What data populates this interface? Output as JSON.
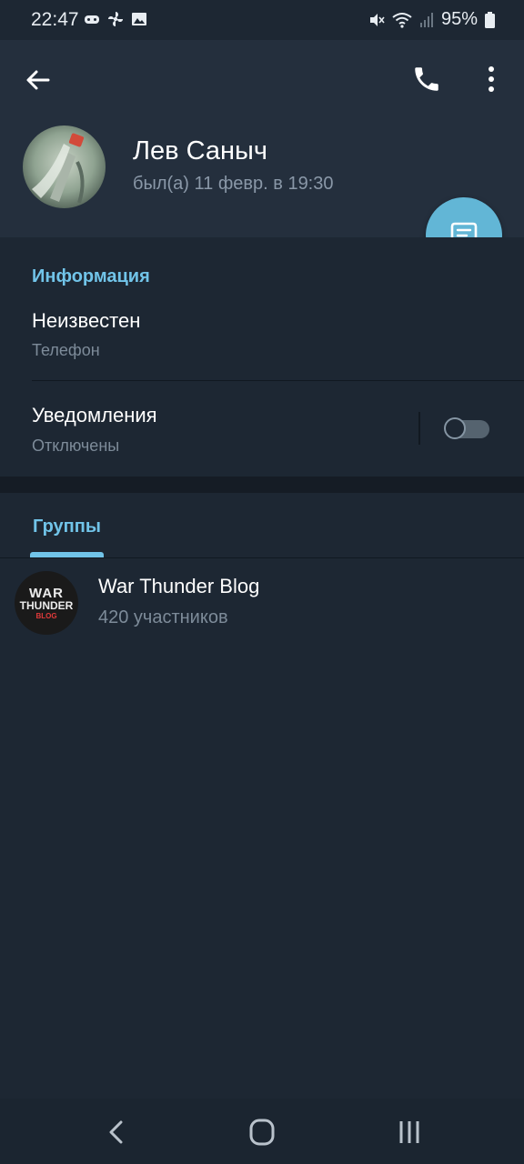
{
  "status_bar": {
    "time": "22:47",
    "battery": "95%",
    "left_icons": [
      "game-controller-icon",
      "fan-icon",
      "image-icon"
    ],
    "right_icons": [
      "mute-icon",
      "wifi-icon",
      "signal-icon",
      "battery-icon"
    ]
  },
  "header": {
    "name": "Лев Саныч",
    "last_seen": "был(а) 11 февр. в 19:30"
  },
  "info": {
    "section_title": "Информация",
    "phone_value": "Неизвестен",
    "phone_label": "Телефон",
    "notifications_title": "Уведомления",
    "notifications_status": "Отключены",
    "notifications_enabled": false
  },
  "groups": {
    "tab_label": "Группы",
    "items": [
      {
        "name": "War Thunder Blog",
        "members": "420 участников",
        "avatar_text": {
          "line1": "WAR",
          "line2": "THUNDER",
          "line3": "BLOG"
        }
      }
    ]
  },
  "colors": {
    "accent": "#71c4e9",
    "fab": "#62b6d6",
    "header_bg": "#242f3d",
    "body_bg": "#1d2733"
  }
}
